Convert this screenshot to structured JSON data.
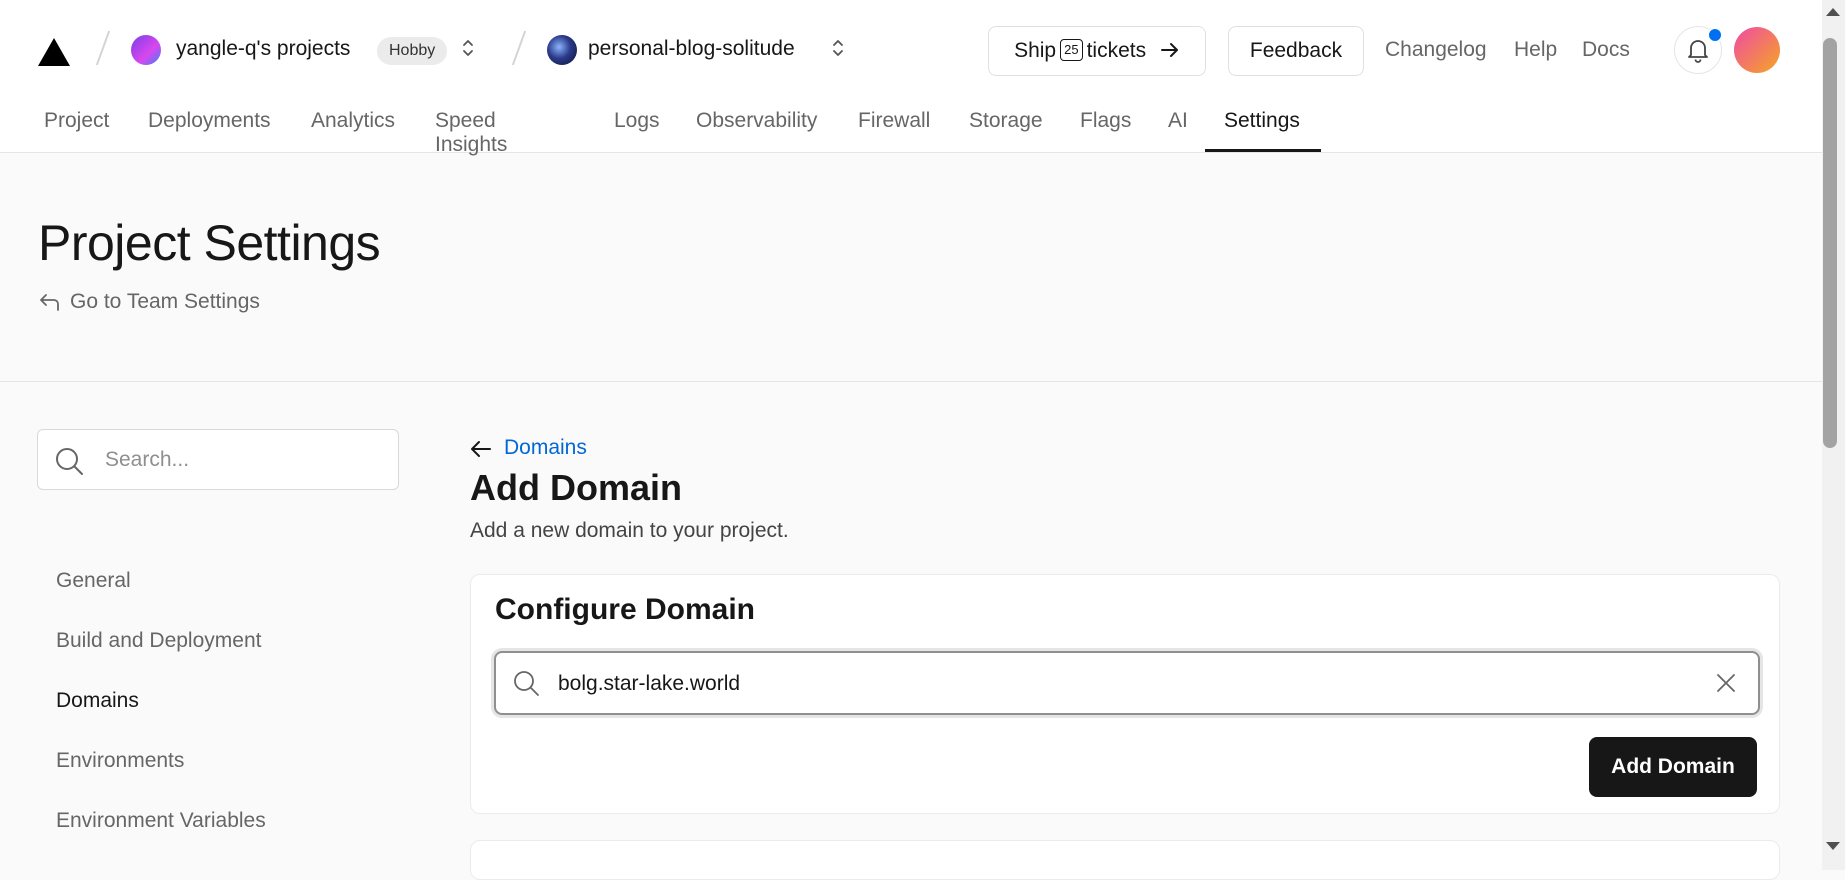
{
  "header": {
    "team": {
      "name": "yangle-q's projects",
      "plan_badge": "Hobby"
    },
    "project": {
      "name": "personal-blog-solitude"
    },
    "ship_button": {
      "prefix": "Ship",
      "count": "25",
      "suffix": "tickets"
    },
    "feedback_label": "Feedback",
    "links": {
      "changelog": "Changelog",
      "help": "Help",
      "docs": "Docs"
    }
  },
  "tabs": [
    {
      "label": "Project"
    },
    {
      "label": "Deployments"
    },
    {
      "label": "Analytics"
    },
    {
      "label": "Speed Insights"
    },
    {
      "label": "Logs"
    },
    {
      "label": "Observability"
    },
    {
      "label": "Firewall"
    },
    {
      "label": "Storage"
    },
    {
      "label": "Flags"
    },
    {
      "label": "AI"
    },
    {
      "label": "Settings",
      "active": true
    }
  ],
  "page": {
    "title": "Project Settings",
    "team_settings_link": "Go to Team Settings"
  },
  "sidebar": {
    "search_placeholder": "Search...",
    "items": [
      {
        "label": "General"
      },
      {
        "label": "Build and Deployment"
      },
      {
        "label": "Domains",
        "active": true
      },
      {
        "label": "Environments"
      },
      {
        "label": "Environment Variables"
      }
    ]
  },
  "main": {
    "back_link": "Domains",
    "title": "Add Domain",
    "subtitle": "Add a new domain to your project.",
    "card": {
      "title": "Configure Domain",
      "domain_value": "bolg.star-lake.world",
      "add_button": "Add Domain"
    }
  },
  "colors": {
    "accent": "#171717",
    "link": "#0068d6",
    "notification_dot": "#0070f3"
  }
}
